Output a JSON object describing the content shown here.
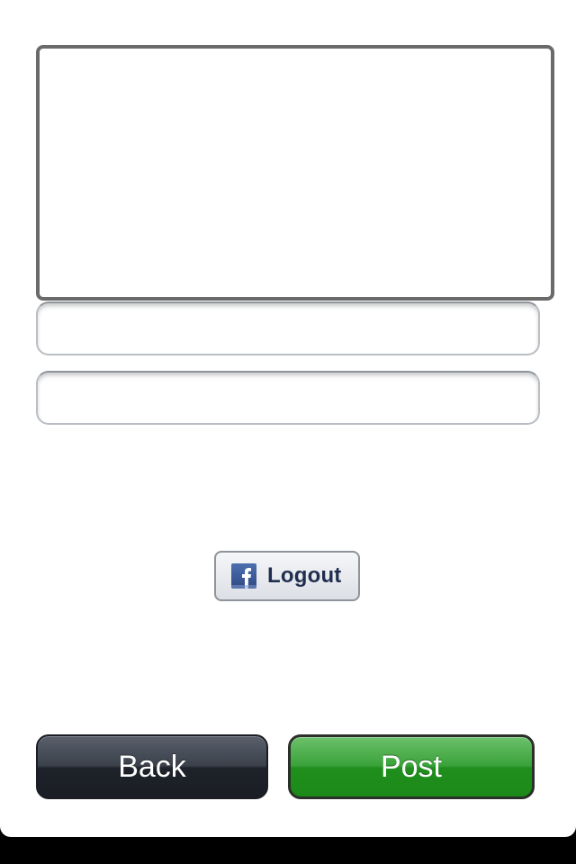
{
  "compose": {
    "message_value": "",
    "field1_value": "",
    "field2_value": ""
  },
  "facebook": {
    "logout_label": "Logout",
    "icon": "facebook-logo-icon",
    "brand_color": "#3b5998"
  },
  "actions": {
    "back_label": "Back",
    "post_label": "Post",
    "back_color": "#1e222a",
    "post_color": "#1f8e1c"
  }
}
